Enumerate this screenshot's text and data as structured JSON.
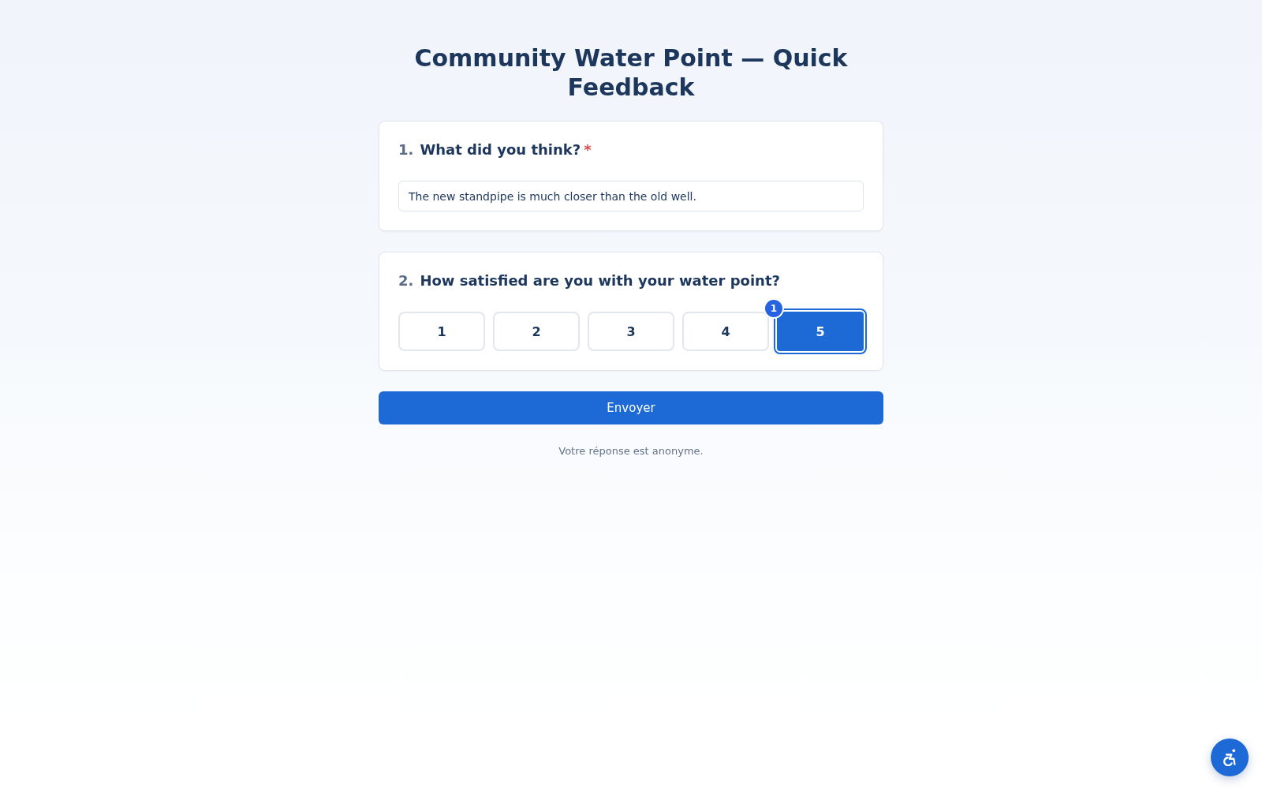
{
  "page": {
    "title": "Community Water Point — Quick Feedback"
  },
  "questions": [
    {
      "kind": "text",
      "number": "1.",
      "title": "What did you think?",
      "required_mark": "*",
      "value": "The new standpipe is much closer than the old well."
    },
    {
      "kind": "rating",
      "number": "2.",
      "title": "How satisfied are you with your water point?",
      "options": [
        {
          "label": "1",
          "selected": false
        },
        {
          "label": "2",
          "selected": false
        },
        {
          "label": "3",
          "selected": false
        },
        {
          "label": "4",
          "selected": false
        },
        {
          "label": "5",
          "selected": true,
          "badge": "1"
        }
      ]
    }
  ],
  "submit": {
    "label": "Envoyer"
  },
  "note": "Votre réponse est anonyme.",
  "accessibility_button": true
}
